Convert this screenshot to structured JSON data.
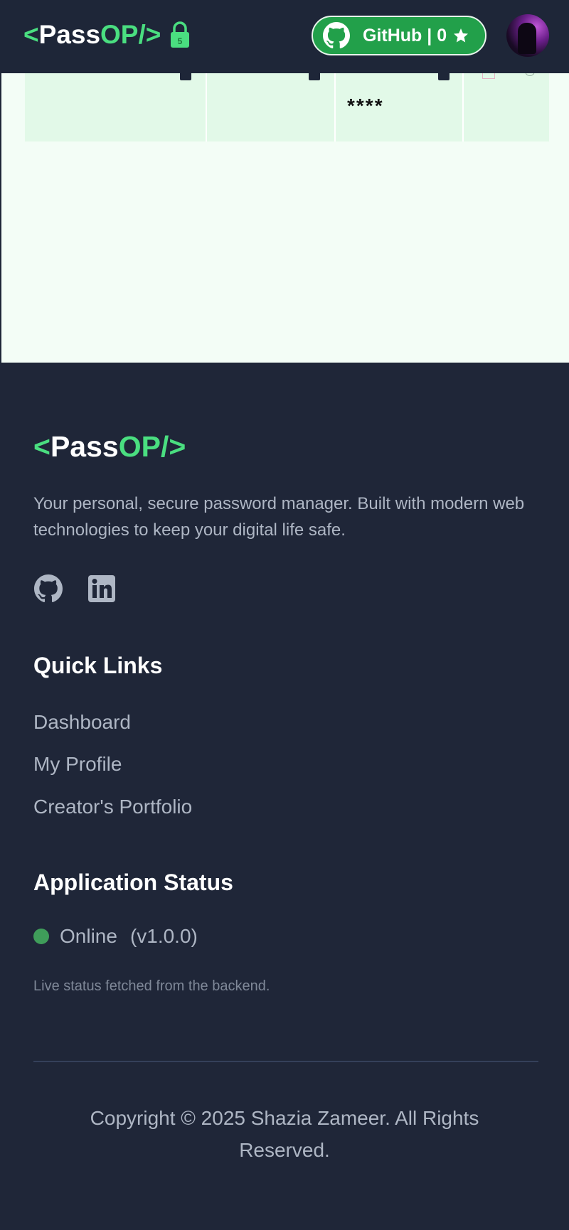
{
  "navbar": {
    "logo": {
      "open": "<",
      "pass": "Pass",
      "op": "OP/",
      "close": " >"
    },
    "lock_badge": "5",
    "github_button": {
      "label": "GitHub | 0",
      "icon": "github-icon",
      "star_icon": "star-icon"
    },
    "avatar": "user-avatar"
  },
  "table": {
    "row": {
      "password_mask": "****"
    }
  },
  "footer": {
    "logo": {
      "open": "<",
      "pass": "Pass",
      "op": "OP/>"
    },
    "description": "Your personal, secure password manager. Built with modern web technologies to keep your digital life safe.",
    "social": [
      "github-icon",
      "linkedin-icon"
    ],
    "quick_links": {
      "heading": "Quick Links",
      "items": [
        "Dashboard",
        "My Profile",
        "Creator's Portfolio"
      ]
    },
    "status": {
      "heading": "Application Status",
      "state": "Online",
      "version": "(v1.0.0)",
      "note": "Live status fetched from the backend.",
      "color": "#3f9d5a"
    },
    "copyright": "Copyright © 2025 Shazia Zameer. All Rights Reserved."
  },
  "colors": {
    "accent": "#4ade80",
    "github_button": "#22a04a",
    "background": "#1e2638",
    "content_bg": "#f3fdf6",
    "row_bg": "#e2f9e8"
  }
}
